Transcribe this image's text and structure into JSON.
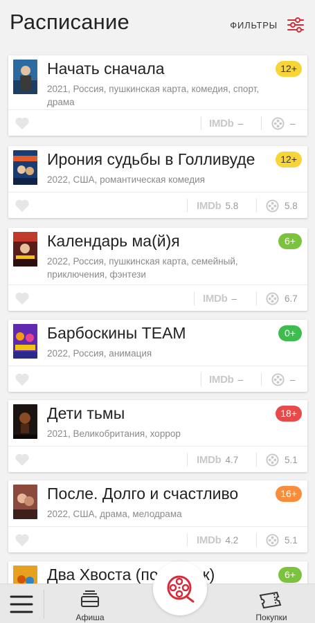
{
  "header": {
    "title": "Расписание",
    "filters_label": "ФИЛЬТРЫ"
  },
  "colors": {
    "age_yellow": "#f7d438",
    "age_green": "#7cc33d",
    "age_green_dark": "#3fbc4f",
    "age_red": "#e84a4a",
    "age_orange": "#f98d3b",
    "accent_red": "#d62b3a"
  },
  "movies": [
    {
      "title": "Начать сначала",
      "meta": "2021, Россия, пушкинская карта, комедия, спорт, драма",
      "age": "12+",
      "imdb": "–",
      "kp": "–"
    },
    {
      "title": "Ирония судьбы в Голливуде",
      "meta": "2022, США, романтическая комедия",
      "age": "12+",
      "imdb": "5.8",
      "kp": "5.8"
    },
    {
      "title": "Календарь ма(й)я",
      "meta": "2022, Россия, пушкинская карта, семейный, приключения, фэнтези",
      "age": "6+",
      "imdb": "–",
      "kp": "6.7"
    },
    {
      "title": "Барбоскины TEAM",
      "meta": "2022, Россия, анимация",
      "age": "0+",
      "imdb": "–",
      "kp": "–"
    },
    {
      "title": "Дети тьмы",
      "meta": "2021, Великобритания, хоррор",
      "age": "18+",
      "imdb": "4.7",
      "kp": "5.1"
    },
    {
      "title": "После. Долго и счастливо",
      "meta": "2022, США, драма, мелодрама",
      "age": "16+",
      "imdb": "4.2",
      "kp": "5.1"
    },
    {
      "title": "Два Хвоста (повыпуск)",
      "meta": "",
      "age": "6+",
      "imdb": "",
      "kp": ""
    }
  ],
  "imdb_label": "IMDb",
  "nav": {
    "afisha_label": "Афиша",
    "purchases_label": "Покупки",
    "icons": [
      "menu-icon",
      "afisha-icon",
      "film-reel-icon",
      "tickets-icon"
    ]
  }
}
